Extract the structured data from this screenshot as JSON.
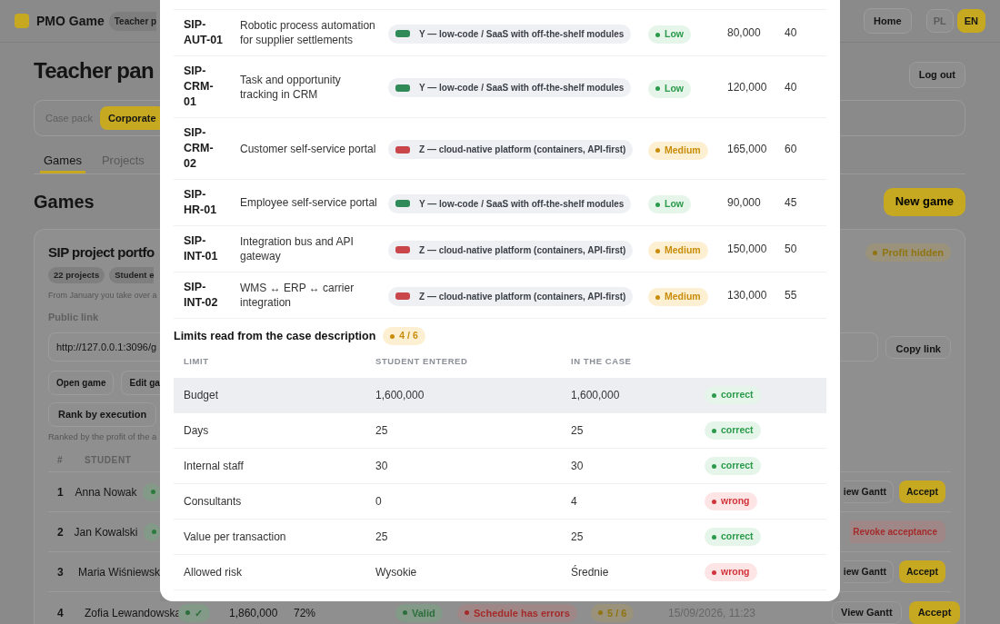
{
  "navbar": {
    "brand": "PMO Game",
    "role_badge": "Teacher p",
    "links": [
      {
        "label": "Home"
      }
    ],
    "languages": [
      {
        "label": "PL",
        "selected": false
      },
      {
        "label": "EN",
        "selected": true
      }
    ]
  },
  "header": {
    "title": "Teacher pan",
    "logout": "Log out"
  },
  "case_pack": {
    "label": "Case pack",
    "options": [
      {
        "label": "Corporate",
        "selected": true
      }
    ]
  },
  "tabs": [
    {
      "label": "Games",
      "selected": true
    },
    {
      "label": "Projects",
      "selected": false
    }
  ],
  "games": {
    "title": "Games",
    "new_game": "New game"
  },
  "game_card": {
    "title": "SIP project portfo",
    "badge": "Profit hidden",
    "chips": [
      "22 projects",
      "Student e"
    ],
    "description": "From January you take over a",
    "link_label": "Public link",
    "link_value": "http://127.0.0.1:3096/g",
    "copy_button": "Copy link",
    "buttons": [
      "Open game",
      "Edit ga"
    ],
    "rank_buttons": [
      "Rank by execution"
    ],
    "ranking_note": "Ranked by the profit of the a",
    "columns": [
      "#",
      "STUDENT"
    ],
    "rows": [
      {
        "rank": "1",
        "student": "Anna Nowak",
        "verified": true,
        "actions": [
          {
            "label": "iew Gantt",
            "kind": "outline"
          },
          {
            "label": "Accept",
            "kind": "primary"
          }
        ]
      },
      {
        "rank": "2",
        "student": "Jan Kowalski",
        "verified": true,
        "actions": [
          {
            "label": "Revoke acceptance",
            "kind": "danger"
          }
        ]
      },
      {
        "rank": "3",
        "student": "Maria Wiśniewsk",
        "actions": [
          {
            "label": "iew Gantt",
            "kind": "outline"
          },
          {
            "label": "Accept",
            "kind": "primary"
          }
        ]
      },
      {
        "rank": "4",
        "student": "Zofia Lewandowska",
        "verified": true,
        "check": "✓",
        "profit": "1,860,000",
        "share": "72%",
        "pills": [
          {
            "label": "Valid",
            "kind": "ok"
          },
          {
            "label": "Schedule has errors",
            "kind": "error"
          },
          {
            "label": "5 / 6",
            "kind": "warn"
          }
        ],
        "submitted": "15/09/2026, 11:23",
        "actions": [
          {
            "label": "View Gantt",
            "kind": "outline"
          },
          {
            "label": "Accept",
            "kind": "primary"
          }
        ]
      }
    ]
  },
  "modal": {
    "projects": [
      {
        "code": "SIP-AUT-01",
        "name": "Robotic process automation for supplier settlements",
        "technology": {
          "label": "Y — low-code / SaaS with off-the-shelf modules",
          "color": "#2f8a58"
        },
        "risk": {
          "label": "Low",
          "kind": "low"
        },
        "cost": "80,000",
        "days": "40"
      },
      {
        "code": "SIP-CRM-01",
        "name": "Task and opportunity tracking in CRM",
        "technology": {
          "label": "Y — low-code / SaaS with off-the-shelf modules",
          "color": "#2f8a58"
        },
        "risk": {
          "label": "Low",
          "kind": "low"
        },
        "cost": "120,000",
        "days": "40"
      },
      {
        "code": "SIP-CRM-02",
        "name": "Customer self-service portal",
        "technology": {
          "label": "Z — cloud-native platform (containers, API-first)",
          "color": "#c9474b"
        },
        "risk": {
          "label": "Medium",
          "kind": "medium"
        },
        "cost": "165,000",
        "days": "60"
      },
      {
        "code": "SIP-HR-01",
        "name": "Employee self-service portal",
        "technology": {
          "label": "Y — low-code / SaaS with off-the-shelf modules",
          "color": "#2f8a58"
        },
        "risk": {
          "label": "Low",
          "kind": "low"
        },
        "cost": "90,000",
        "days": "45"
      },
      {
        "code": "SIP-INT-01",
        "name": "Integration bus and API gateway",
        "technology": {
          "label": "Z — cloud-native platform (containers, API-first)",
          "color": "#c9474b"
        },
        "risk": {
          "label": "Medium",
          "kind": "medium"
        },
        "cost": "150,000",
        "days": "50"
      },
      {
        "code": "SIP-INT-02",
        "name": "WMS ↔ ERP ↔ carrier integration",
        "technology": {
          "label": "Z — cloud-native platform (containers, API-first)",
          "color": "#c9474b"
        },
        "risk": {
          "label": "Medium",
          "kind": "medium"
        },
        "cost": "130,000",
        "days": "55"
      }
    ],
    "limits": {
      "title": "Limits read from the case description",
      "score": "4 / 6",
      "columns": [
        "LIMIT",
        "STUDENT ENTERED",
        "IN THE CASE"
      ],
      "rows": [
        {
          "limit": "Budget",
          "entered": "1,600,000",
          "actual": "1,600,000",
          "result": {
            "label": "correct",
            "kind": "correct"
          },
          "highlighted": true
        },
        {
          "limit": "Days",
          "entered": "25",
          "actual": "25",
          "result": {
            "label": "correct",
            "kind": "correct"
          },
          "highlighted": false
        },
        {
          "limit": "Internal staff",
          "entered": "30",
          "actual": "30",
          "result": {
            "label": "correct",
            "kind": "correct"
          },
          "highlighted": false
        },
        {
          "limit": "Consultants",
          "entered": "0",
          "actual": "4",
          "result": {
            "label": "wrong",
            "kind": "wrong"
          },
          "highlighted": false
        },
        {
          "limit": "Value per transaction",
          "entered": "25",
          "actual": "25",
          "result": {
            "label": "correct",
            "kind": "correct"
          },
          "highlighted": false
        },
        {
          "limit": "Allowed risk",
          "entered": "Wysokie",
          "actual": "Średnie",
          "result": {
            "label": "wrong",
            "kind": "wrong"
          },
          "highlighted": false
        }
      ]
    }
  }
}
